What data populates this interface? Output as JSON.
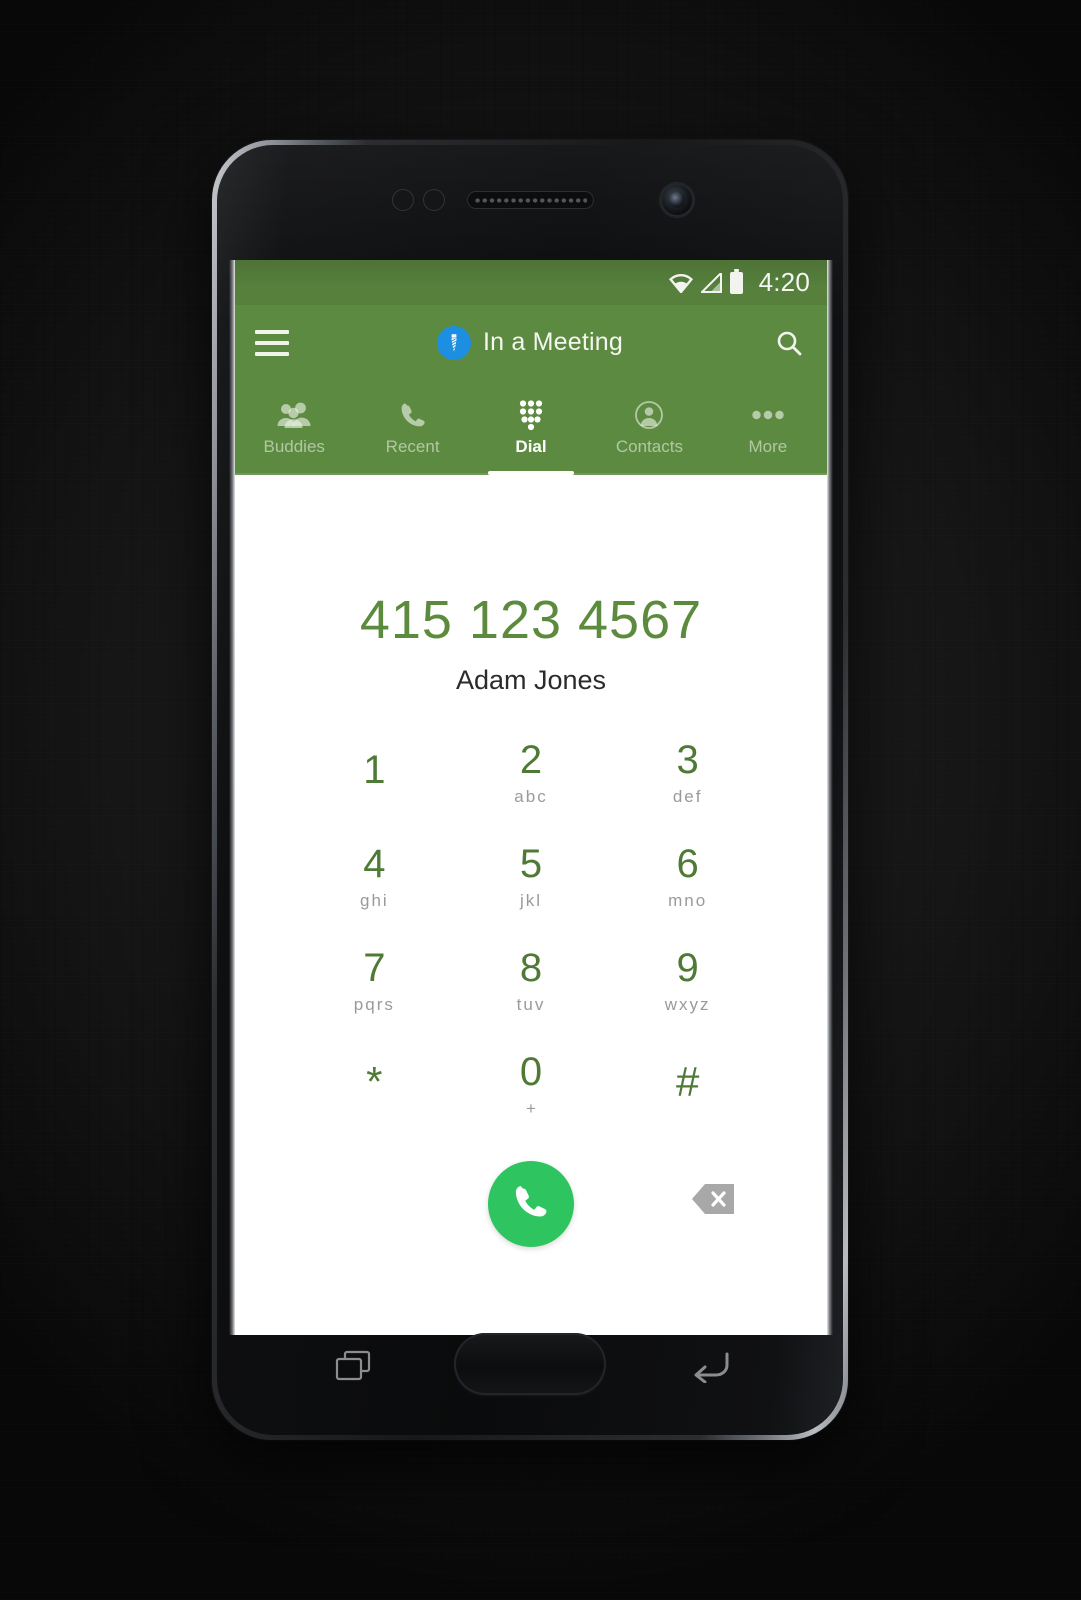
{
  "statusbar": {
    "time": "4:20",
    "icons": [
      "wifi-icon",
      "cell-signal-icon",
      "battery-icon"
    ]
  },
  "appbar": {
    "menu_icon": "hamburger-menu-icon",
    "avatar_icon": "necktie-status-icon",
    "avatar_color": "#1d8fe0",
    "title": "In a Meeting",
    "search_icon": "search-icon"
  },
  "tabs": {
    "active": "Dial",
    "items": [
      {
        "label": "Buddies",
        "icon": "buddies-group-icon"
      },
      {
        "label": "Recent",
        "icon": "phone-handset-icon"
      },
      {
        "label": "Dial",
        "icon": "dialpad-icon"
      },
      {
        "label": "Contacts",
        "icon": "contact-person-icon"
      },
      {
        "label": "More",
        "icon": "more-dots-icon"
      }
    ]
  },
  "dialer": {
    "number": "415 123 4567",
    "contact_name": "Adam Jones",
    "number_color": "#5c8b3e",
    "keys": [
      {
        "digit": "1",
        "letters": ""
      },
      {
        "digit": "2",
        "letters": "abc"
      },
      {
        "digit": "3",
        "letters": "def"
      },
      {
        "digit": "4",
        "letters": "ghi"
      },
      {
        "digit": "5",
        "letters": "jkl"
      },
      {
        "digit": "6",
        "letters": "mno"
      },
      {
        "digit": "7",
        "letters": "pqrs"
      },
      {
        "digit": "8",
        "letters": "tuv"
      },
      {
        "digit": "9",
        "letters": "wxyz"
      },
      {
        "digit": "*",
        "letters": ""
      },
      {
        "digit": "0",
        "letters": "+"
      },
      {
        "digit": "#",
        "letters": ""
      }
    ],
    "call_button_icon": "call-phone-icon",
    "call_button_color": "#2ec45f",
    "backspace_icon": "backspace-delete-icon"
  },
  "device": {
    "top_hardware": [
      "proximity-sensor",
      "light-sensor",
      "earpiece-speaker",
      "front-camera"
    ],
    "bottom_hardware": [
      "recents-button",
      "home-button",
      "back-button"
    ]
  },
  "theme": {
    "statusbar_green": "#56803c",
    "appbar_green": "#5d8a41",
    "key_green": "#4f7a36"
  }
}
